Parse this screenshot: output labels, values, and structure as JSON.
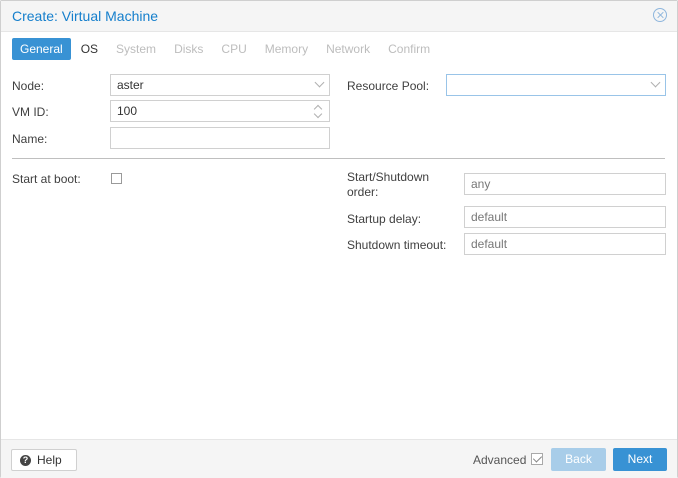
{
  "window": {
    "title": "Create: Virtual Machine"
  },
  "tabs": [
    "General",
    "OS",
    "System",
    "Disks",
    "CPU",
    "Memory",
    "Network",
    "Confirm"
  ],
  "general": {
    "node_label": "Node:",
    "node_value": "aster",
    "vmid_label": "VM ID:",
    "vmid_value": "100",
    "name_label": "Name:",
    "name_value": "",
    "pool_label": "Resource Pool:",
    "pool_value": ""
  },
  "boot": {
    "start_at_boot_label": "Start at boot:",
    "start_at_boot_checked": false,
    "order_label": "Start/Shutdown order:",
    "order_placeholder": "any",
    "startup_delay_label": "Startup delay:",
    "startup_delay_placeholder": "default",
    "shutdown_timeout_label": "Shutdown timeout:",
    "shutdown_timeout_placeholder": "default"
  },
  "footer": {
    "help_label": "Help",
    "advanced_label": "Advanced",
    "advanced_checked": true,
    "back_label": "Back",
    "next_label": "Next"
  },
  "colors": {
    "accent": "#3892d4",
    "title": "#157fcc",
    "disabled_button": "#a8cde9"
  },
  "icons": {
    "close": "close-circle-icon",
    "help": "question-circle-icon"
  }
}
